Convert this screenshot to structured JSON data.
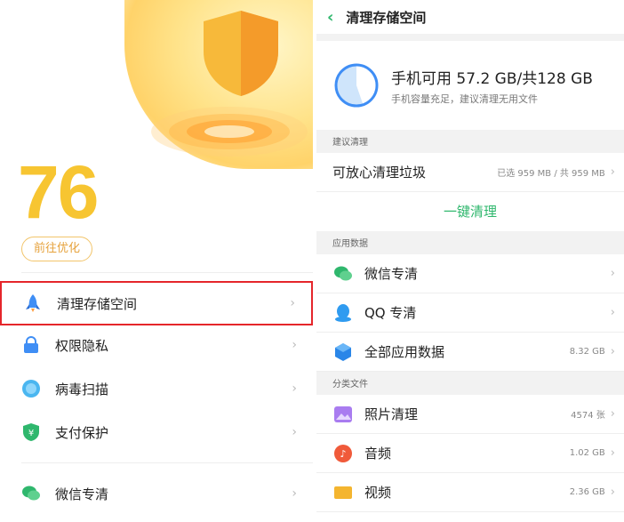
{
  "left": {
    "score": "76",
    "optimize_button": "前往优化",
    "menu": [
      {
        "label": "清理存储空间",
        "icon": "rocket-icon"
      },
      {
        "label": "权限隐私",
        "icon": "lock-icon"
      },
      {
        "label": "病毒扫描",
        "icon": "scan-icon"
      },
      {
        "label": "支付保护",
        "icon": "yen-shield-icon"
      },
      {
        "label": "微信专清",
        "icon": "wechat-icon"
      }
    ],
    "chevron": "›"
  },
  "right": {
    "title": "清理存储空间",
    "storage": {
      "main": "手机可用 57.2 GB/共128 GB",
      "sub": "手机容量充足，建议清理无用文件",
      "used_fraction": 0.553
    },
    "sections": {
      "suggest": "建议清理",
      "app_data": "应用数据",
      "files": "分类文件"
    },
    "junk": {
      "label": "可放心清理垃圾",
      "value": "已选 959 MB / 共 959 MB"
    },
    "onekey": "一键清理",
    "app_rows": [
      {
        "label": "微信专清",
        "value": "",
        "icon": "wechat-icon"
      },
      {
        "label": "QQ 专清",
        "value": "",
        "icon": "qq-icon"
      },
      {
        "label": "全部应用数据",
        "value": "8.32 GB",
        "icon": "cube-icon"
      }
    ],
    "file_rows": [
      {
        "label": "照片清理",
        "value": "4574 张",
        "icon": "photo-icon"
      },
      {
        "label": "音频",
        "value": "1.02 GB",
        "icon": "music-icon"
      },
      {
        "label": "视频",
        "value": "2.36 GB",
        "icon": "video-icon"
      }
    ],
    "chevron": "›",
    "accent": "#2fb76d"
  }
}
